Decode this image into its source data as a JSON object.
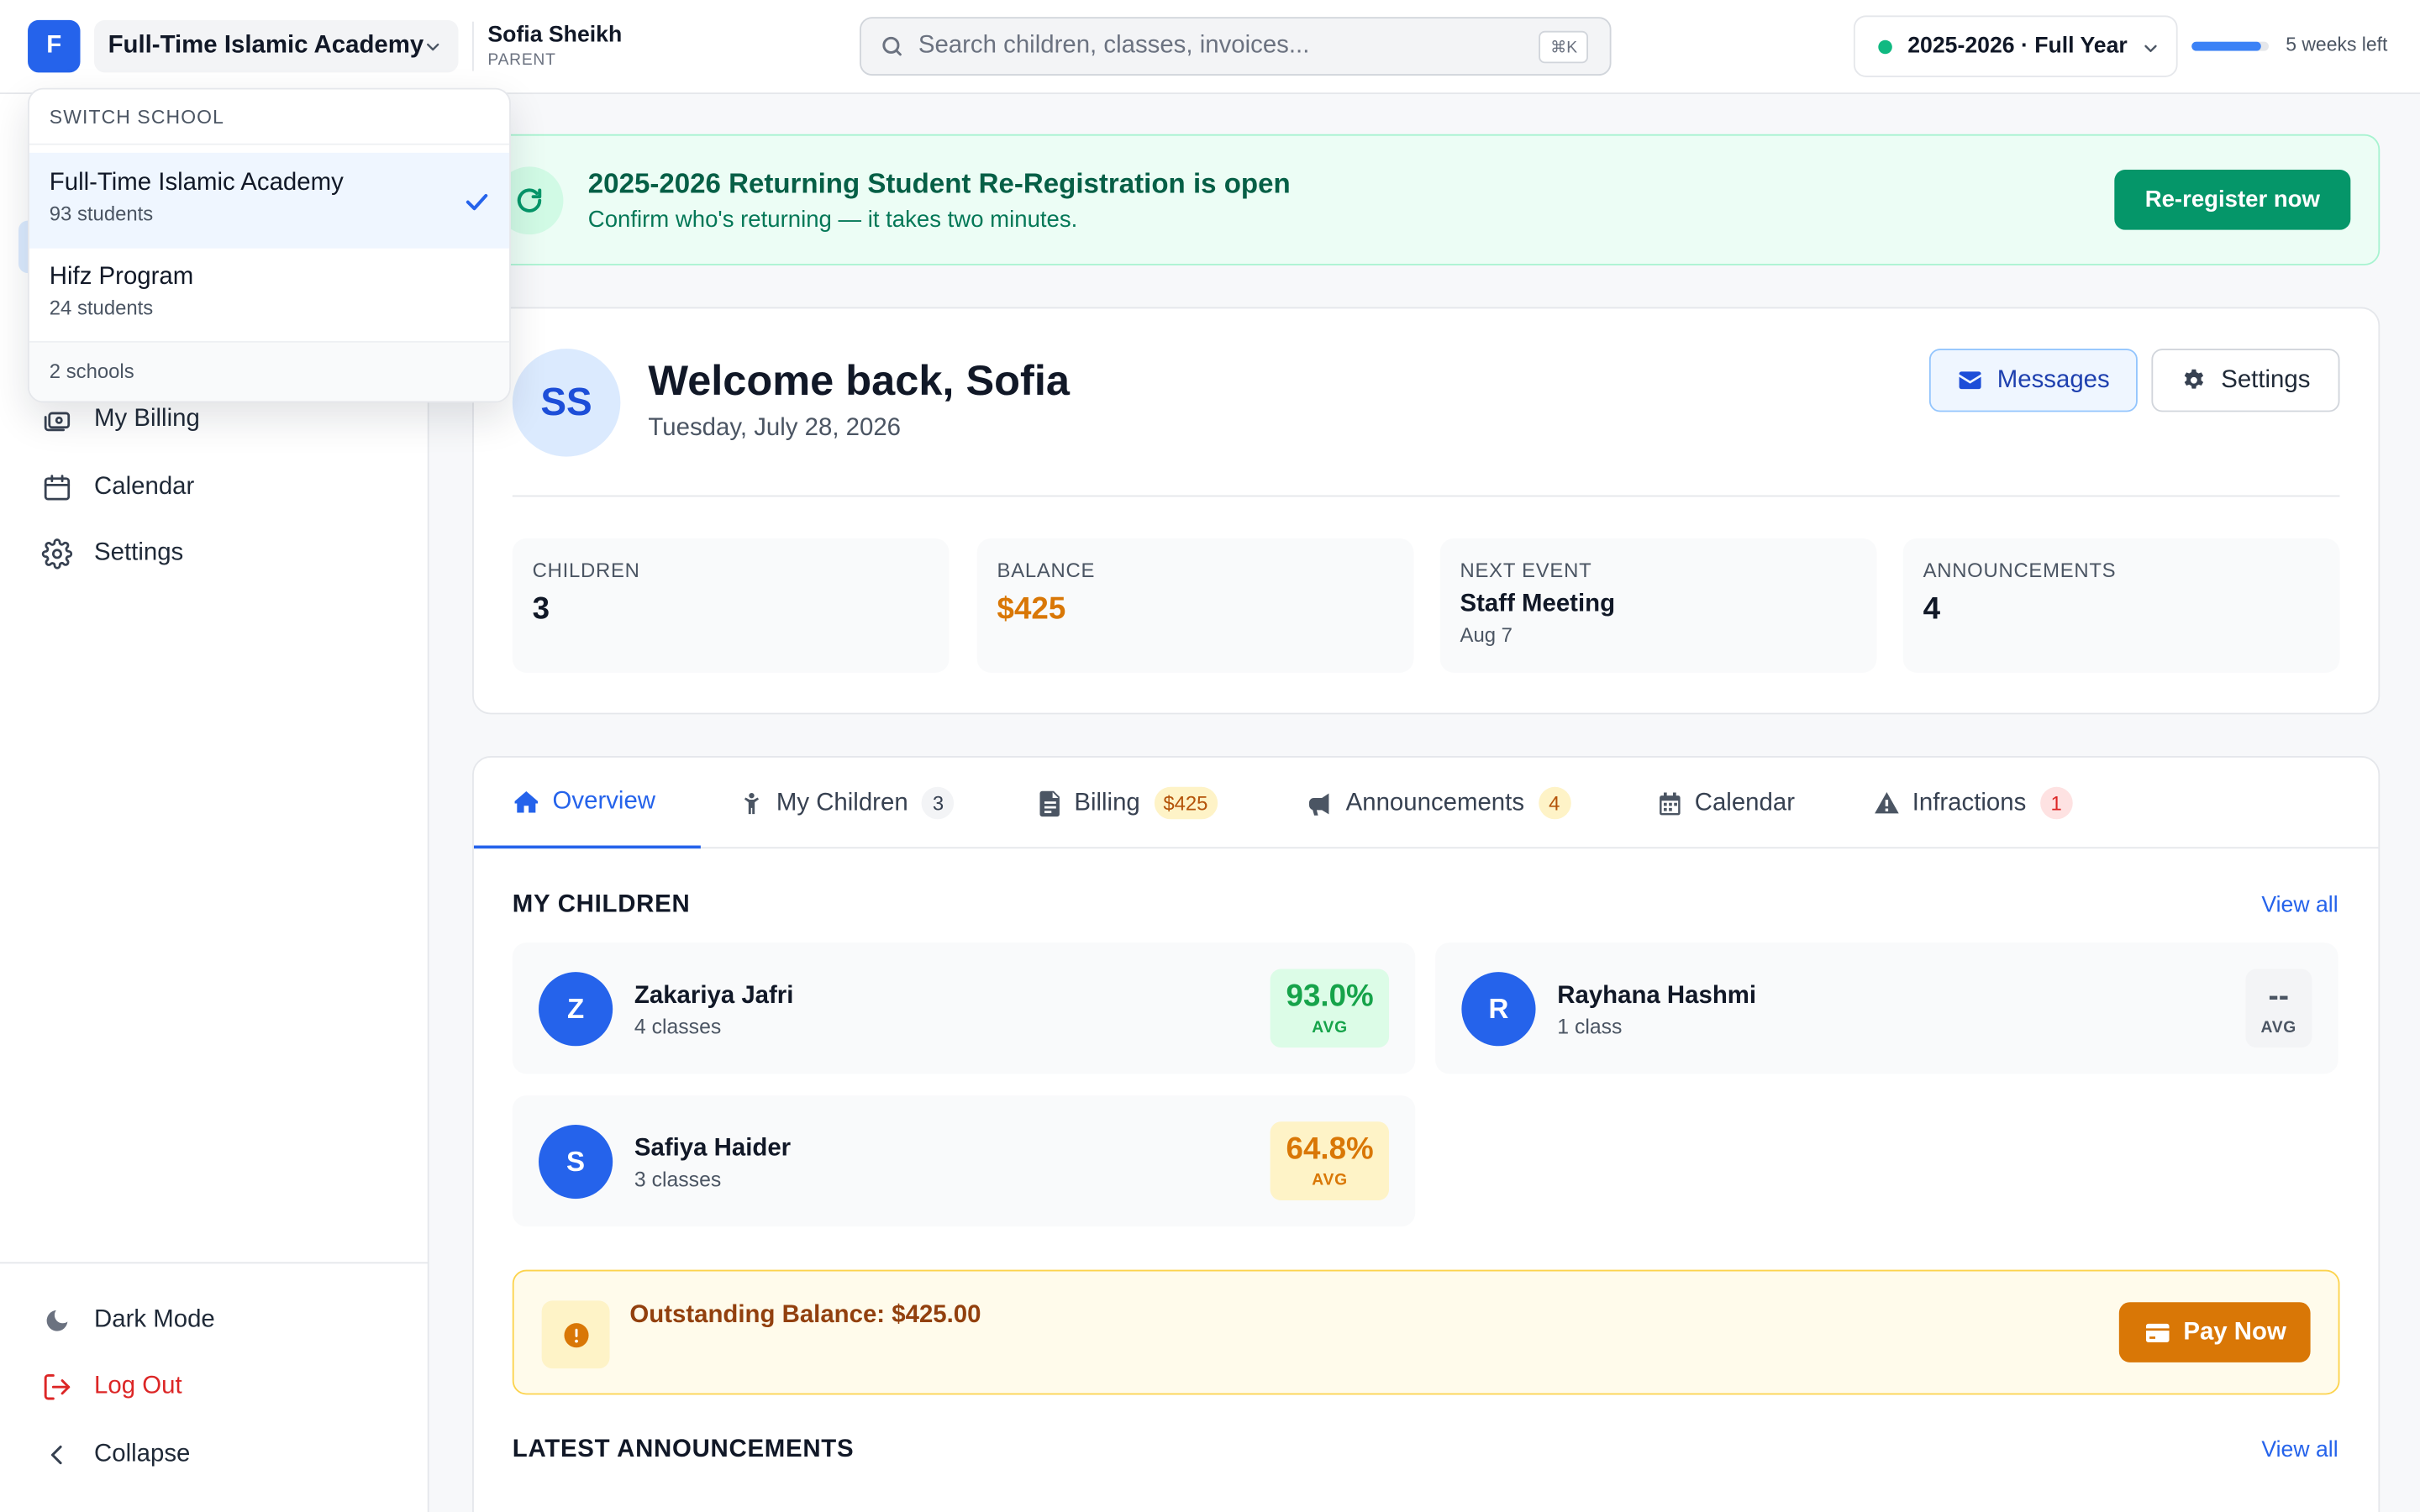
{
  "topbar": {
    "logo_letter": "F",
    "school_name": "Full-Time Islamic Academy",
    "user_name": "Sofia Sheikh",
    "user_role": "PARENT",
    "search_placeholder": "Search children, classes, invoices...",
    "search_shortcut": "⌘K",
    "year_label": "2025-2026 · Full Year",
    "year_status_color": "#10b981",
    "term_progress_fraction": 0.9,
    "weeks_left": "5 weeks left"
  },
  "school_switcher": {
    "heading": "SWITCH SCHOOL",
    "items": [
      {
        "name": "Full-Time Islamic Academy",
        "count": "93 students",
        "selected": true
      },
      {
        "name": "Hifz Program",
        "count": "24 students",
        "selected": false
      }
    ],
    "footer": "2 schools"
  },
  "sidebar": {
    "items": [
      {
        "label": "My Billing",
        "icon": "wallet-icon"
      },
      {
        "label": "Calendar",
        "icon": "calendar-icon"
      },
      {
        "label": "Settings",
        "icon": "gear-icon"
      }
    ],
    "footer": {
      "dark_mode": "Dark Mode",
      "logout": "Log Out",
      "collapse": "Collapse"
    }
  },
  "banner": {
    "title": "2025-2026 Returning Student Re-Registration is open",
    "subtitle": "Confirm who's returning — it takes two minutes.",
    "button": "Re-register now"
  },
  "welcome": {
    "initials": "SS",
    "greeting": "Welcome back, Sofia",
    "date": "Tuesday, July 28, 2026",
    "messages_button": "Messages",
    "settings_button": "Settings",
    "stats": {
      "children_label": "CHILDREN",
      "children_value": "3",
      "balance_label": "BALANCE",
      "balance_value": "$425",
      "event_label": "NEXT EVENT",
      "event_name": "Staff Meeting",
      "event_date": "Aug 7",
      "announcements_label": "ANNOUNCEMENTS",
      "announcements_value": "4"
    }
  },
  "tabs": [
    {
      "label": "Overview",
      "badge": ""
    },
    {
      "label": "My Children",
      "badge": "3"
    },
    {
      "label": "Billing",
      "badge": "$425"
    },
    {
      "label": "Announcements",
      "badge": "4"
    },
    {
      "label": "Calendar",
      "badge": ""
    },
    {
      "label": "Infractions",
      "badge": "1"
    }
  ],
  "overview": {
    "children_title": "MY CHILDREN",
    "view_all": "View all",
    "avg_label": "AVG",
    "children": [
      {
        "initial": "Z",
        "name": "Zakariya Jafri",
        "classes": "4 classes",
        "avg": "93.0%"
      },
      {
        "initial": "R",
        "name": "Rayhana Hashmi",
        "classes": "1 class",
        "avg": "--"
      },
      {
        "initial": "S",
        "name": "Safiya Haider",
        "classes": "3 classes",
        "avg": "64.8%"
      }
    ],
    "balance_text": "Outstanding Balance: $425.00",
    "pay_button": "Pay Now",
    "announcements_title": "LATEST ANNOUNCEMENTS",
    "announcements_view_all": "View all"
  }
}
